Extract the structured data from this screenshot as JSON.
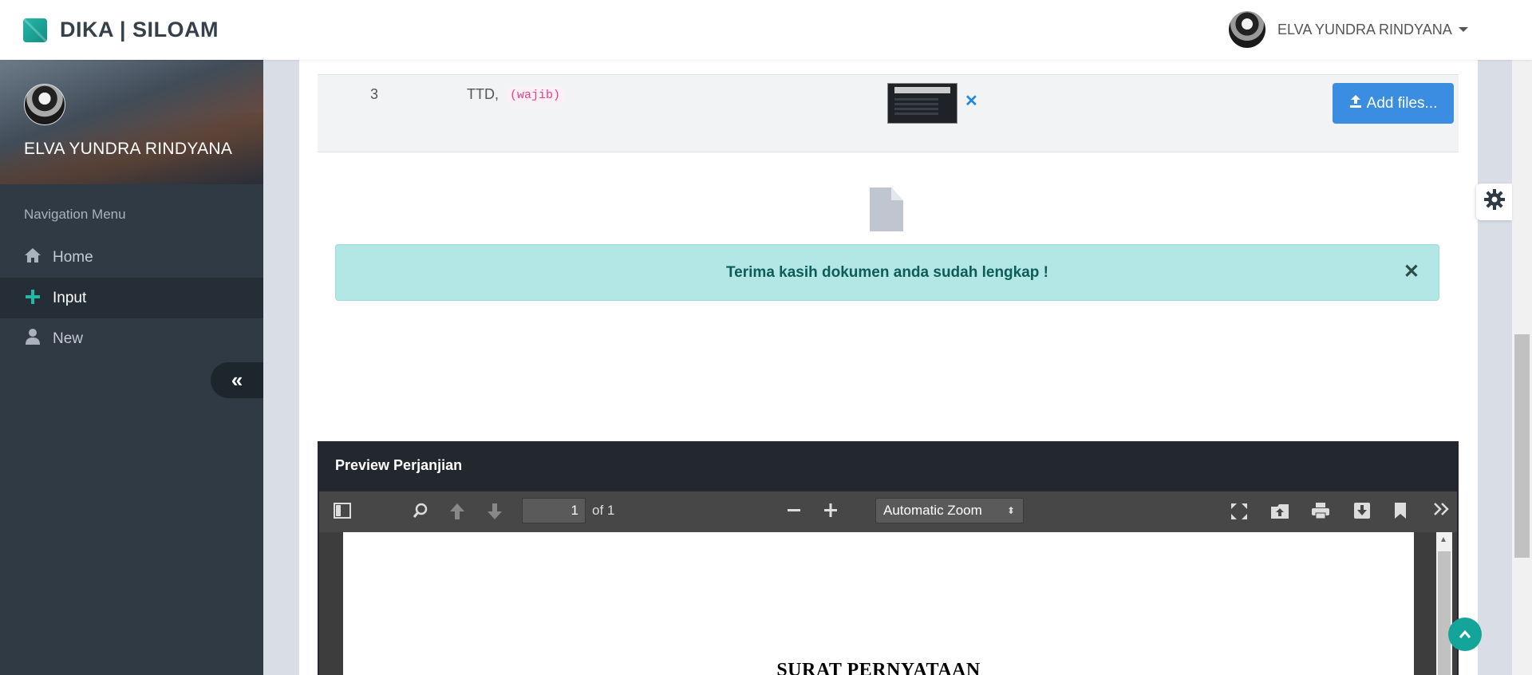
{
  "header": {
    "brand": "DIKA | SILOAM",
    "user_name": "ELVA YUNDRA RINDYANA"
  },
  "sidebar": {
    "user_name": "ELVA YUNDRA RINDYANA",
    "nav_title": "Navigation Menu",
    "items": [
      {
        "label": "Home",
        "icon": "home-icon"
      },
      {
        "label": "Input",
        "icon": "plus-icon",
        "active": true
      },
      {
        "label": "New",
        "icon": "user-icon"
      }
    ],
    "collapse_icon": "«"
  },
  "files_table": {
    "row": {
      "number": "3",
      "label": "TTD,",
      "tag": "(wajib)",
      "remove_icon": "✕",
      "add_button": "Add files..."
    }
  },
  "alert": {
    "message": "Terima kasih dokumen anda sudah lengkap !",
    "close": "✕"
  },
  "preview": {
    "title": "Preview Perjanjian",
    "page_number": "1",
    "page_total": "of 1",
    "zoom": "Automatic Zoom",
    "document_title": "SURAT PERNYATAAN"
  },
  "colors": {
    "accent": "#22b8a8",
    "sidebar": "#2f3a45",
    "alert_bg": "#b3e7e5",
    "button_blue": "#3a8de0"
  }
}
